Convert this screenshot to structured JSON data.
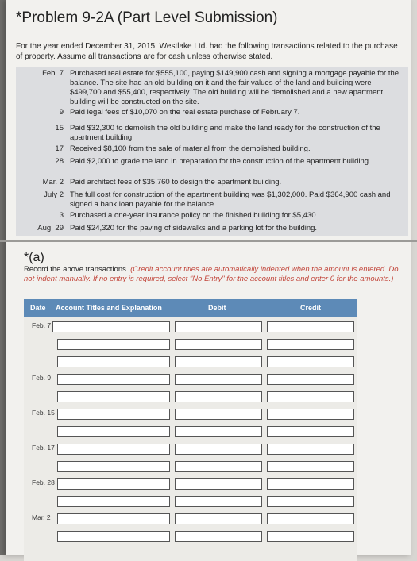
{
  "title": "*Problem 9-2A (Part Level Submission)",
  "intro": "For the year ended December 31, 2015, Westlake Ltd. had the following transactions related to the purchase of property. Assume all transactions are for cash unless otherwise stated.",
  "transactions": [
    {
      "date": "Feb. 7",
      "text": "Purchased real estate for $555,100, paying $149,900 cash and signing a mortgage payable for the balance. The site had an old building on it and the fair values of the land and building were $499,700 and $55,400, respectively. The old building will be demolished and a new apartment building will be constructed on the site."
    },
    {
      "date": "9",
      "text": "Paid legal fees of $10,070 on the real estate purchase of February 7."
    },
    {
      "date": "15",
      "text": "Paid $32,300 to demolish the old building and make the land ready for the construction of the apartment building."
    },
    {
      "date": "17",
      "text": "Received $8,100 from the sale of material from the demolished building."
    },
    {
      "date": "28",
      "text": "Paid $2,000 to grade the land in preparation for the construction of the apartment building."
    },
    {
      "date": "Mar. 2",
      "text": "Paid architect fees of $35,760 to design the apartment building."
    },
    {
      "date": "July 2",
      "text": "The full cost for construction of the apartment building was $1,302,000. Paid $364,900 cash and signed a bank loan payable for the balance."
    },
    {
      "date": "3",
      "text": "Purchased a one-year insurance policy on the finished building for $5,430."
    },
    {
      "date": "Aug. 29",
      "text": "Paid $24,320 for the paving of sidewalks and a parking lot for the building."
    }
  ],
  "part_a": {
    "label": "*(a)",
    "instruction_plain": "Record the above transactions.",
    "instruction_note": "(Credit account titles are automatically indented when the amount is entered. Do not indent manually. If no entry is required, select \"No Entry\" for the account titles and enter 0 for the amounts.)"
  },
  "journal": {
    "headers": {
      "date": "Date",
      "account": "Account Titles and Explanation",
      "debit": "Debit",
      "credit": "Credit"
    },
    "dates": [
      "Feb. 7",
      "Feb. 9",
      "Feb. 15",
      "Feb. 17",
      "Feb. 28",
      "Mar. 2"
    ]
  },
  "colors": {
    "header_bg": "#5d8ab7",
    "note_red": "#c2453a",
    "tx_bg": "#dcdde0"
  }
}
